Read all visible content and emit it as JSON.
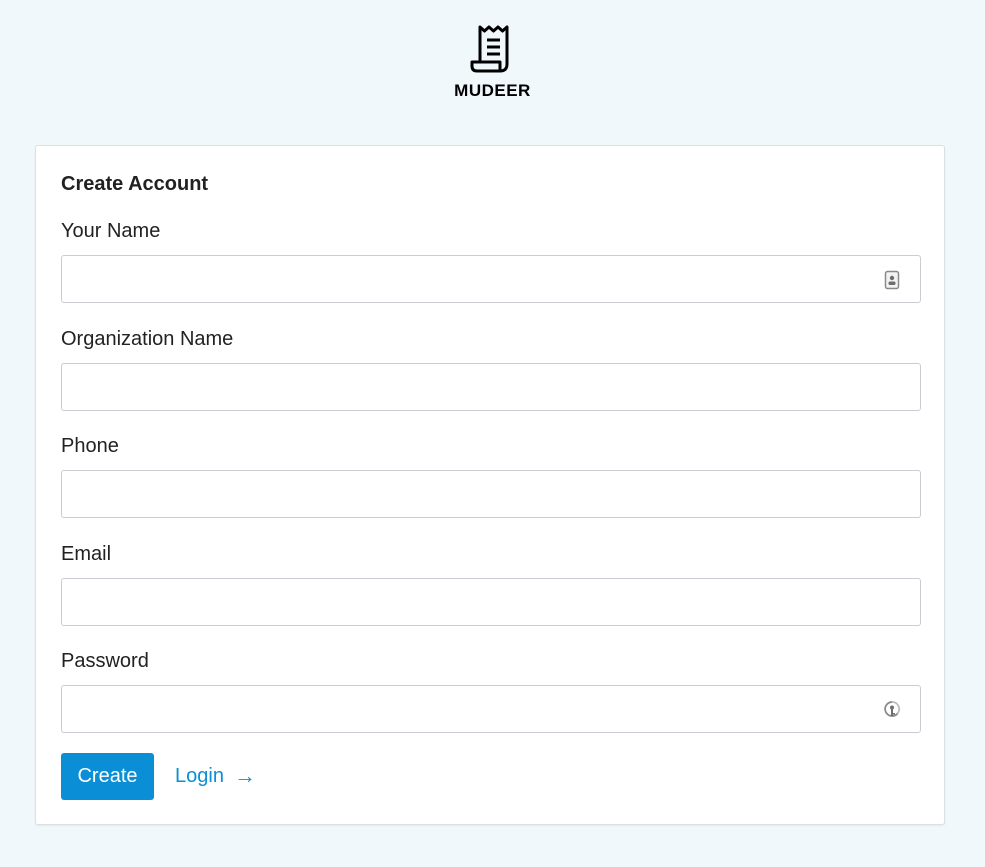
{
  "brand": {
    "name": "MUDEER"
  },
  "form": {
    "title": "Create Account",
    "fields": [
      {
        "label": "Your Name",
        "value": "",
        "icon": "contact-card-icon"
      },
      {
        "label": "Organization Name",
        "value": ""
      },
      {
        "label": "Phone",
        "value": ""
      },
      {
        "label": "Email",
        "value": ""
      },
      {
        "label": "Password",
        "value": "",
        "icon": "password-key-icon"
      }
    ],
    "create_label": "Create",
    "login_label": "Login",
    "login_arrow": "→"
  },
  "colors": {
    "background": "#f1f8fb",
    "accent": "#0a8fd6",
    "card": "#ffffff",
    "input_border": "#c9ccd1"
  }
}
